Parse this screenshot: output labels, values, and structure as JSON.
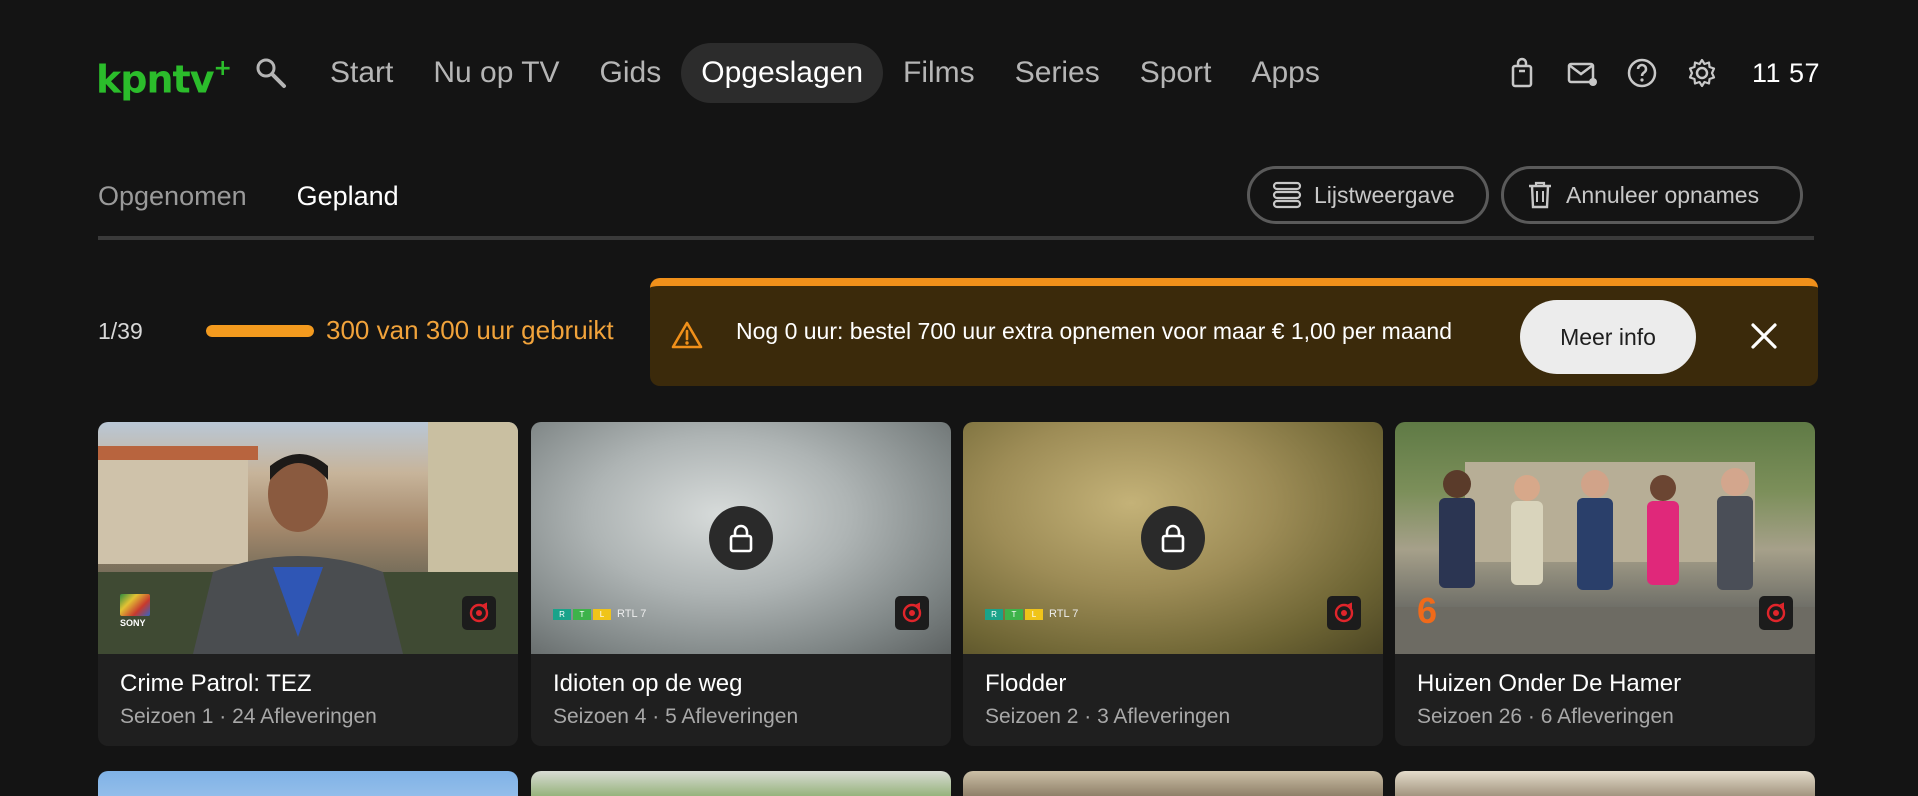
{
  "app": {
    "logo_text": "kpntv",
    "logo_plus": "+"
  },
  "nav": {
    "items": [
      {
        "label": "Start",
        "active": false
      },
      {
        "label": "Nu op TV",
        "active": false
      },
      {
        "label": "Gids",
        "active": false
      },
      {
        "label": "Opgeslagen",
        "active": true
      },
      {
        "label": "Films",
        "active": false
      },
      {
        "label": "Series",
        "active": false
      },
      {
        "label": "Sport",
        "active": false
      },
      {
        "label": "Apps",
        "active": false
      }
    ],
    "icons": [
      "search-icon",
      "shopping-bag-icon",
      "mail-icon",
      "help-icon",
      "settings-icon"
    ],
    "clock": "11 57"
  },
  "subtabs": {
    "items": [
      {
        "label": "Opgenomen",
        "active": false
      },
      {
        "label": "Gepland",
        "active": true
      }
    ],
    "list_view_label": "Lijstweergave",
    "cancel_label": "Annuleer opnames"
  },
  "storage": {
    "counter": "1/39",
    "used_text": "300 van 300 uur gebruikt",
    "used_fraction": 1.0
  },
  "banner": {
    "text": "Nog 0 uur: bestel 700 uur extra opnemen voor maar € 1,00 per maand",
    "button_label": "Meer info",
    "accent": "#f0901a"
  },
  "cards": [
    {
      "title": "Crime Patrol: TEZ",
      "subtitle": "Seizoen 1 · 24 Afleveringen",
      "channel": "SONY",
      "locked": false
    },
    {
      "title": "Idioten op de weg",
      "subtitle": "Seizoen 4 · 5 Afleveringen",
      "channel": "RTL 7",
      "locked": true
    },
    {
      "title": "Flodder",
      "subtitle": "Seizoen 2 · 3 Afleveringen",
      "channel": "RTL 7",
      "locked": true
    },
    {
      "title": "Huizen Onder De Hamer",
      "subtitle": "Seizoen 26 · 6 Afleveringen",
      "channel": "6",
      "locked": false
    }
  ],
  "colors": {
    "background": "#141414",
    "brand_green": "#2bbd2b",
    "warning_orange": "#f39a1e",
    "record_red": "#e0252b"
  }
}
